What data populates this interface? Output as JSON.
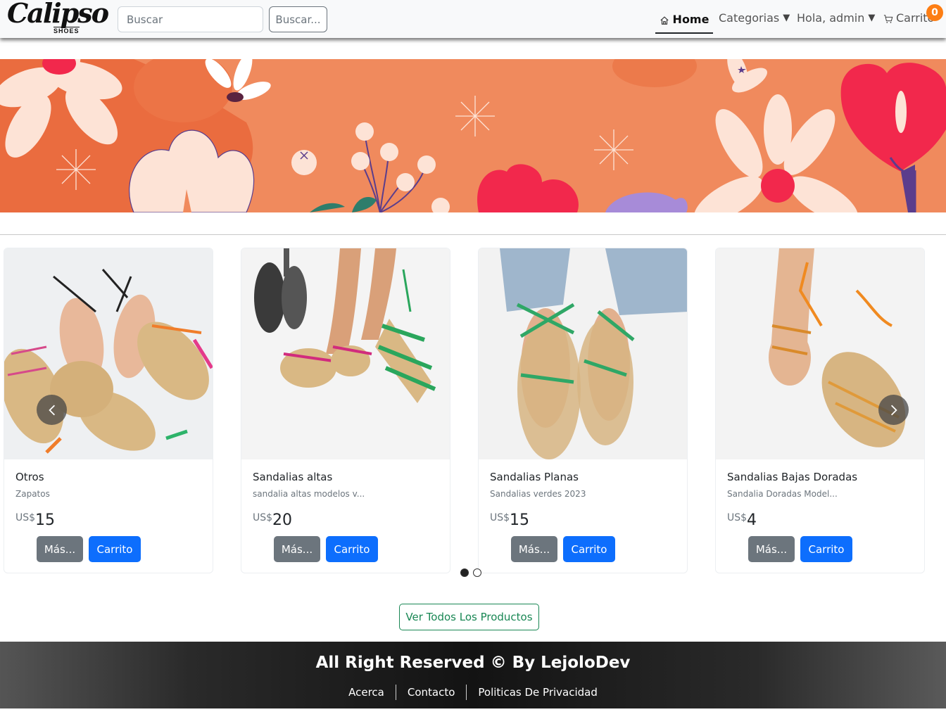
{
  "navbar": {
    "logo_text": "Calipso",
    "logo_sub": "SHOES",
    "search_placeholder": "Buscar",
    "search_button": "Buscar...",
    "home": "Home",
    "categories": "Categorias",
    "user_menu": "Hola, admin",
    "cart": "Carrito",
    "cart_count": "0"
  },
  "products": [
    {
      "title": "Otros",
      "desc": "Zapatos",
      "currency": "US$",
      "price": "15",
      "more": "Más...",
      "cart": "Carrito"
    },
    {
      "title": "Sandalias altas",
      "desc": "sandalia altas modelos v...",
      "currency": "US$",
      "price": "20",
      "more": "Más...",
      "cart": "Carrito"
    },
    {
      "title": "Sandalias Planas",
      "desc": "Sandalias verdes 2023",
      "currency": "US$",
      "price": "15",
      "more": "Más...",
      "cart": "Carrito"
    },
    {
      "title": "Sandalias Bajas Doradas",
      "desc": "Sandalia Doradas Model...",
      "currency": "US$",
      "price": "4",
      "more": "Más...",
      "cart": "Carrito"
    }
  ],
  "view_all": "Ver Todos Los Productos",
  "footer": {
    "title": "All Right Reserved © By LejoloDev",
    "links": [
      "Acerca",
      "Contacto",
      "Politicas De Privacidad"
    ]
  },
  "colors": {
    "primary": "#0d6efd",
    "secondary": "#6c757d",
    "success": "#198754",
    "badge": "#fd7e14",
    "banner": "#f08a5d"
  }
}
